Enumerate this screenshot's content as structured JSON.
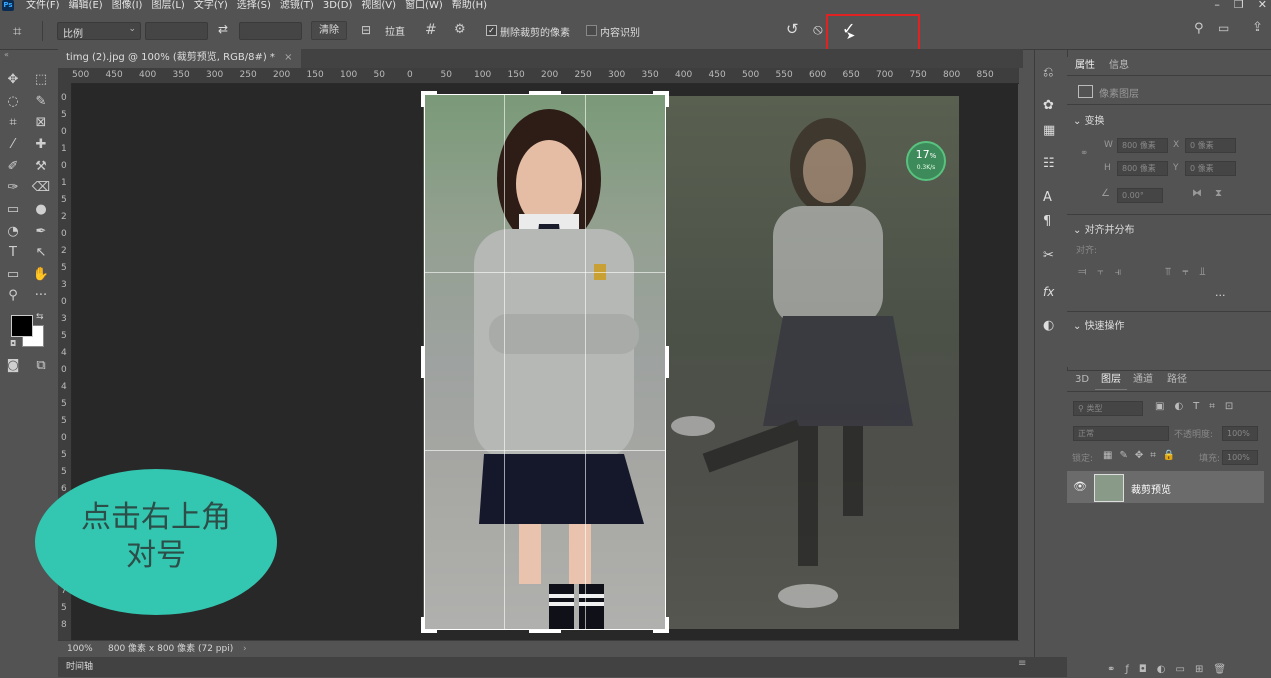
{
  "menu": {
    "logo": "Ps",
    "items": [
      "文件(F)",
      "编辑(E)",
      "图像(I)",
      "图层(L)",
      "文字(Y)",
      "选择(S)",
      "滤镜(T)",
      "3D(D)",
      "视图(V)",
      "窗口(W)",
      "帮助(H)"
    ]
  },
  "options": {
    "ratio_select": "比例",
    "clear_label": "清除",
    "straighten_label": "拉直",
    "delete_cropped_label": "删除裁剪的像素",
    "content_aware_label": "内容识别"
  },
  "document": {
    "tab_title": "timg (2).jpg @ 100% (裁剪预览, RGB/8#) *",
    "zoom": "100%",
    "doc_info": "800 像素 x 800 像素 (72 ppi)"
  },
  "ruler": {
    "h_labels": [
      "500",
      "450",
      "400",
      "350",
      "300",
      "250",
      "200",
      "150",
      "100",
      "50",
      "0",
      "50",
      "100",
      "150",
      "200",
      "250",
      "300",
      "350",
      "400",
      "450",
      "500",
      "550",
      "600",
      "650",
      "700",
      "750",
      "800",
      "850"
    ],
    "v_labels": [
      "0",
      "5",
      "0",
      "1",
      "0",
      "1",
      "5",
      "2",
      "0",
      "2",
      "5",
      "3",
      "0",
      "3",
      "5",
      "4",
      "0",
      "4",
      "5",
      "5",
      "0",
      "5",
      "5",
      "6",
      "0",
      "6",
      "5",
      "7",
      "0",
      "7",
      "5",
      "8"
    ]
  },
  "progress_badge": {
    "percent": "17",
    "unit": "%",
    "rate": "0.3K/s"
  },
  "annotation": {
    "line1": "点击右上角",
    "line2": "对号"
  },
  "timeline_label": "时间轴",
  "properties_panel": {
    "tabs": [
      "属性",
      "信息"
    ],
    "layer_type": "像素图层",
    "transform_header": "变换",
    "w_label": "W",
    "w_value": "800 像素",
    "x_label": "X",
    "x_value": "0 像素",
    "h_label": "H",
    "h_value": "800 像素",
    "y_label": "Y",
    "y_value": "0 像素",
    "angle_value": "0.00°",
    "align_header": "对齐并分布",
    "align_sub": "对齐:",
    "quick_header": "快速操作"
  },
  "layers_panel": {
    "tabs": [
      "3D",
      "图层",
      "通道",
      "路径"
    ],
    "filter_label": "类型",
    "blend_mode": "正常",
    "opacity_label": "不透明度:",
    "opacity_value": "100%",
    "lock_label": "锁定:",
    "fill_label": "填充:",
    "fill_value": "100%",
    "layer_name": "裁剪预览"
  }
}
